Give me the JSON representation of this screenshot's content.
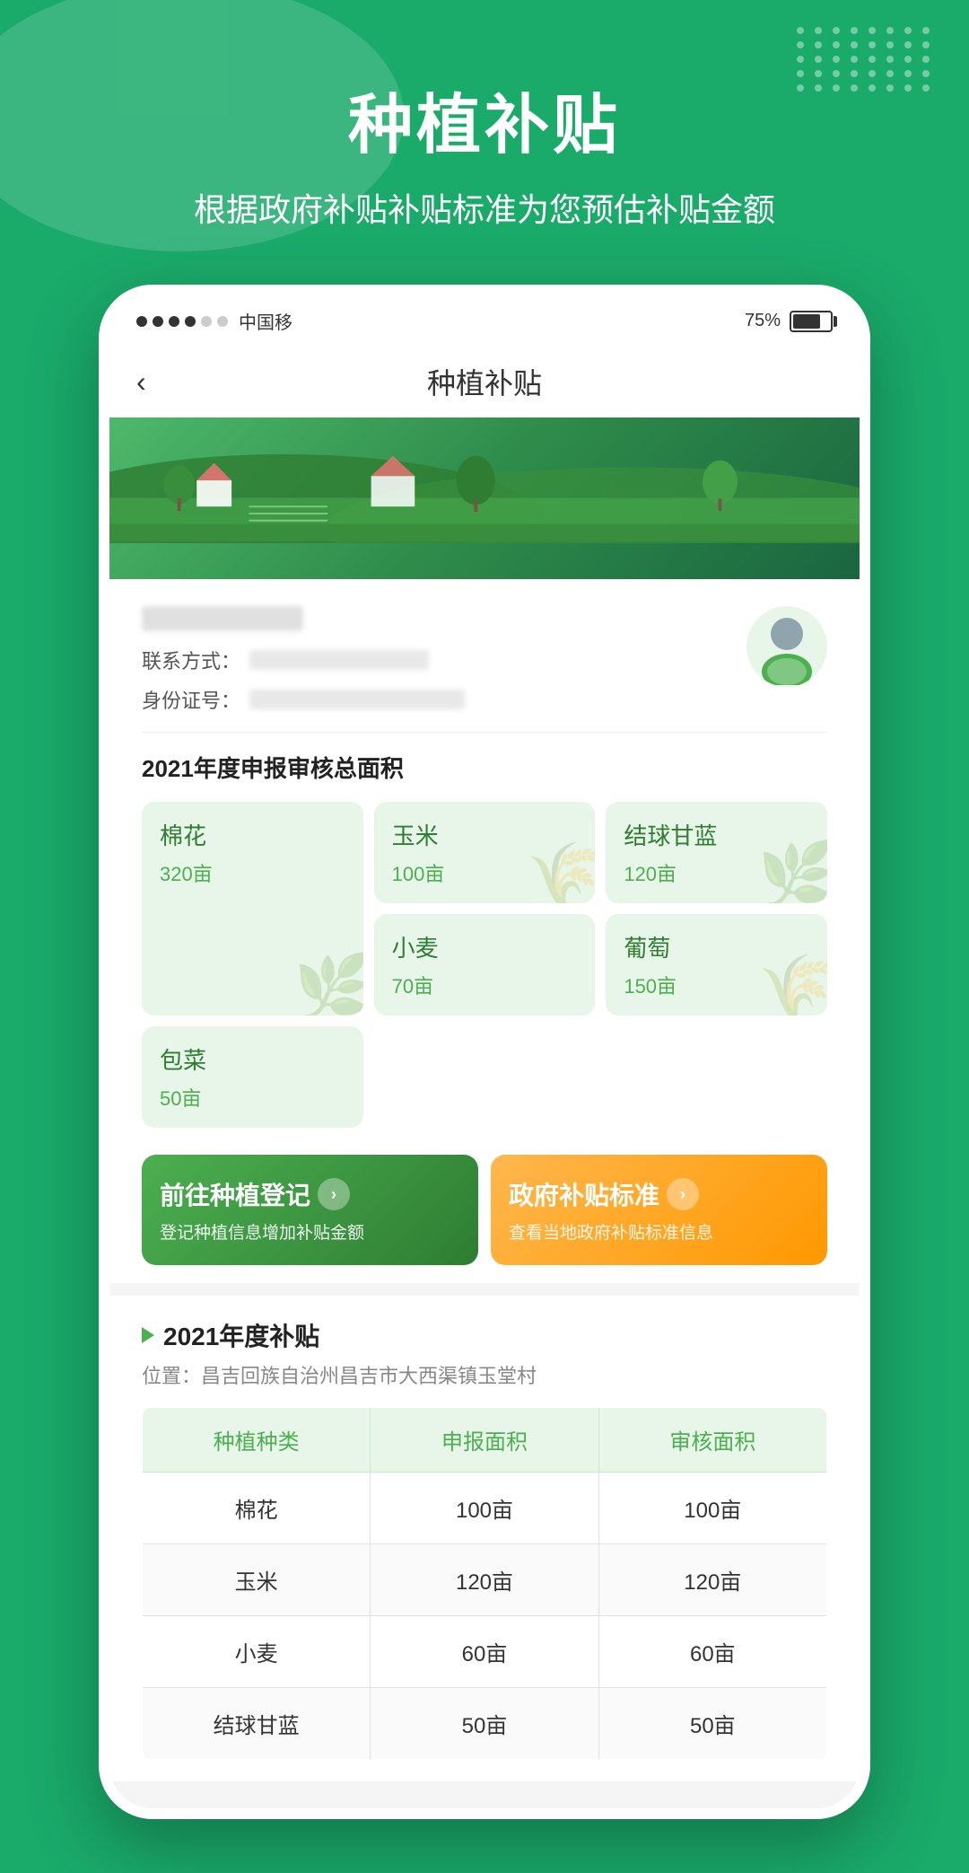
{
  "hero": {
    "title": "种植补贴",
    "subtitle": "根据政府补贴补贴标准为您预估补贴金额"
  },
  "status_bar": {
    "signal_dots": [
      true,
      true,
      true,
      true,
      false,
      false
    ],
    "carrier": "中国移",
    "battery_percent": "75%"
  },
  "app_header": {
    "back_label": "‹",
    "title": "种植补贴"
  },
  "user_card": {
    "contact_label": "联系方式：",
    "id_label": "身份证号："
  },
  "area_section": {
    "title": "2021年度申报审核总面积",
    "crops": [
      {
        "name": "棉花",
        "area": "320亩",
        "large": true
      },
      {
        "name": "玉米",
        "area": "100亩"
      },
      {
        "name": "结球甘蓝",
        "area": "120亩"
      },
      {
        "name": "小麦",
        "area": "70亩"
      },
      {
        "name": "包菜",
        "area": "50亩"
      },
      {
        "name": "葡萄",
        "area": "150亩"
      }
    ]
  },
  "action_buttons": {
    "register": {
      "title": "前往种植登记",
      "subtitle": "登记种植信息增加补贴金额"
    },
    "standard": {
      "title": "政府补贴标准",
      "subtitle": "查看当地政府补贴标准信息"
    }
  },
  "subsidy_section": {
    "title": "2021年度补贴",
    "location": "位置：昌吉回族自治州昌吉市大西渠镇玉堂村",
    "table": {
      "headers": [
        "种植种类",
        "申报面积",
        "审核面积"
      ],
      "rows": [
        {
          "crop": "棉花",
          "declared": "100亩",
          "reviewed": "100亩"
        },
        {
          "crop": "玉米",
          "declared": "120亩",
          "reviewed": "120亩"
        },
        {
          "crop": "小麦",
          "declared": "60亩",
          "reviewed": "60亩"
        },
        {
          "crop": "结球甘蓝",
          "declared": "50亩",
          "reviewed": "50亩"
        }
      ]
    }
  }
}
